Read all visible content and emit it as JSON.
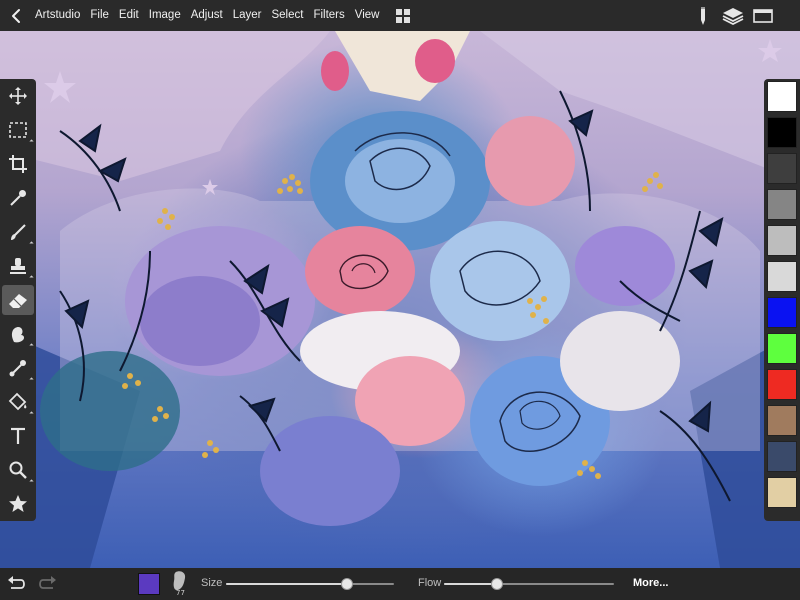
{
  "menu": {
    "items": [
      "Artstudio",
      "File",
      "Edit",
      "Image",
      "Adjust",
      "Layer",
      "Select",
      "Filters",
      "View"
    ]
  },
  "toolbar_right": {
    "icons": [
      "pencil-icon",
      "layers-icon",
      "window-icon"
    ]
  },
  "tools": [
    {
      "name": "move-tool",
      "icon": "move-icon",
      "active": false
    },
    {
      "name": "select-tool",
      "icon": "marquee-icon",
      "active": false
    },
    {
      "name": "crop-tool",
      "icon": "crop-icon",
      "active": false
    },
    {
      "name": "eyedropper-tool",
      "icon": "eyedropper-icon",
      "active": false
    },
    {
      "name": "brush-tool",
      "icon": "brush-icon",
      "active": false
    },
    {
      "name": "stamp-tool",
      "icon": "stamp-icon",
      "active": false
    },
    {
      "name": "eraser-tool",
      "icon": "eraser-icon",
      "active": true
    },
    {
      "name": "smudge-tool",
      "icon": "smudge-icon",
      "active": false
    },
    {
      "name": "dodge-tool",
      "icon": "dodge-icon",
      "active": false
    },
    {
      "name": "fill-tool",
      "icon": "fill-bucket-icon",
      "active": false
    },
    {
      "name": "text-tool",
      "icon": "text-icon",
      "active": false
    },
    {
      "name": "zoom-tool",
      "icon": "magnifier-icon",
      "active": false
    },
    {
      "name": "favorites-tool",
      "icon": "star-icon",
      "active": false
    }
  ],
  "palette": {
    "swatches": [
      "#ffffff",
      "#000000",
      "#3e3e3e",
      "#858585",
      "#bdbdbd",
      "#d9d9d9",
      "#0a12f2",
      "#5eff3e",
      "#ee2a22",
      "#a07b5e",
      "#3a4a6a",
      "#e2cfa4"
    ]
  },
  "bottom": {
    "current_color": "#5b3ac0",
    "brush_size_value": "77",
    "size_label": "Size",
    "size_value": 0.72,
    "flow_label": "Flow",
    "flow_value": 0.31,
    "more_label": "More..."
  }
}
